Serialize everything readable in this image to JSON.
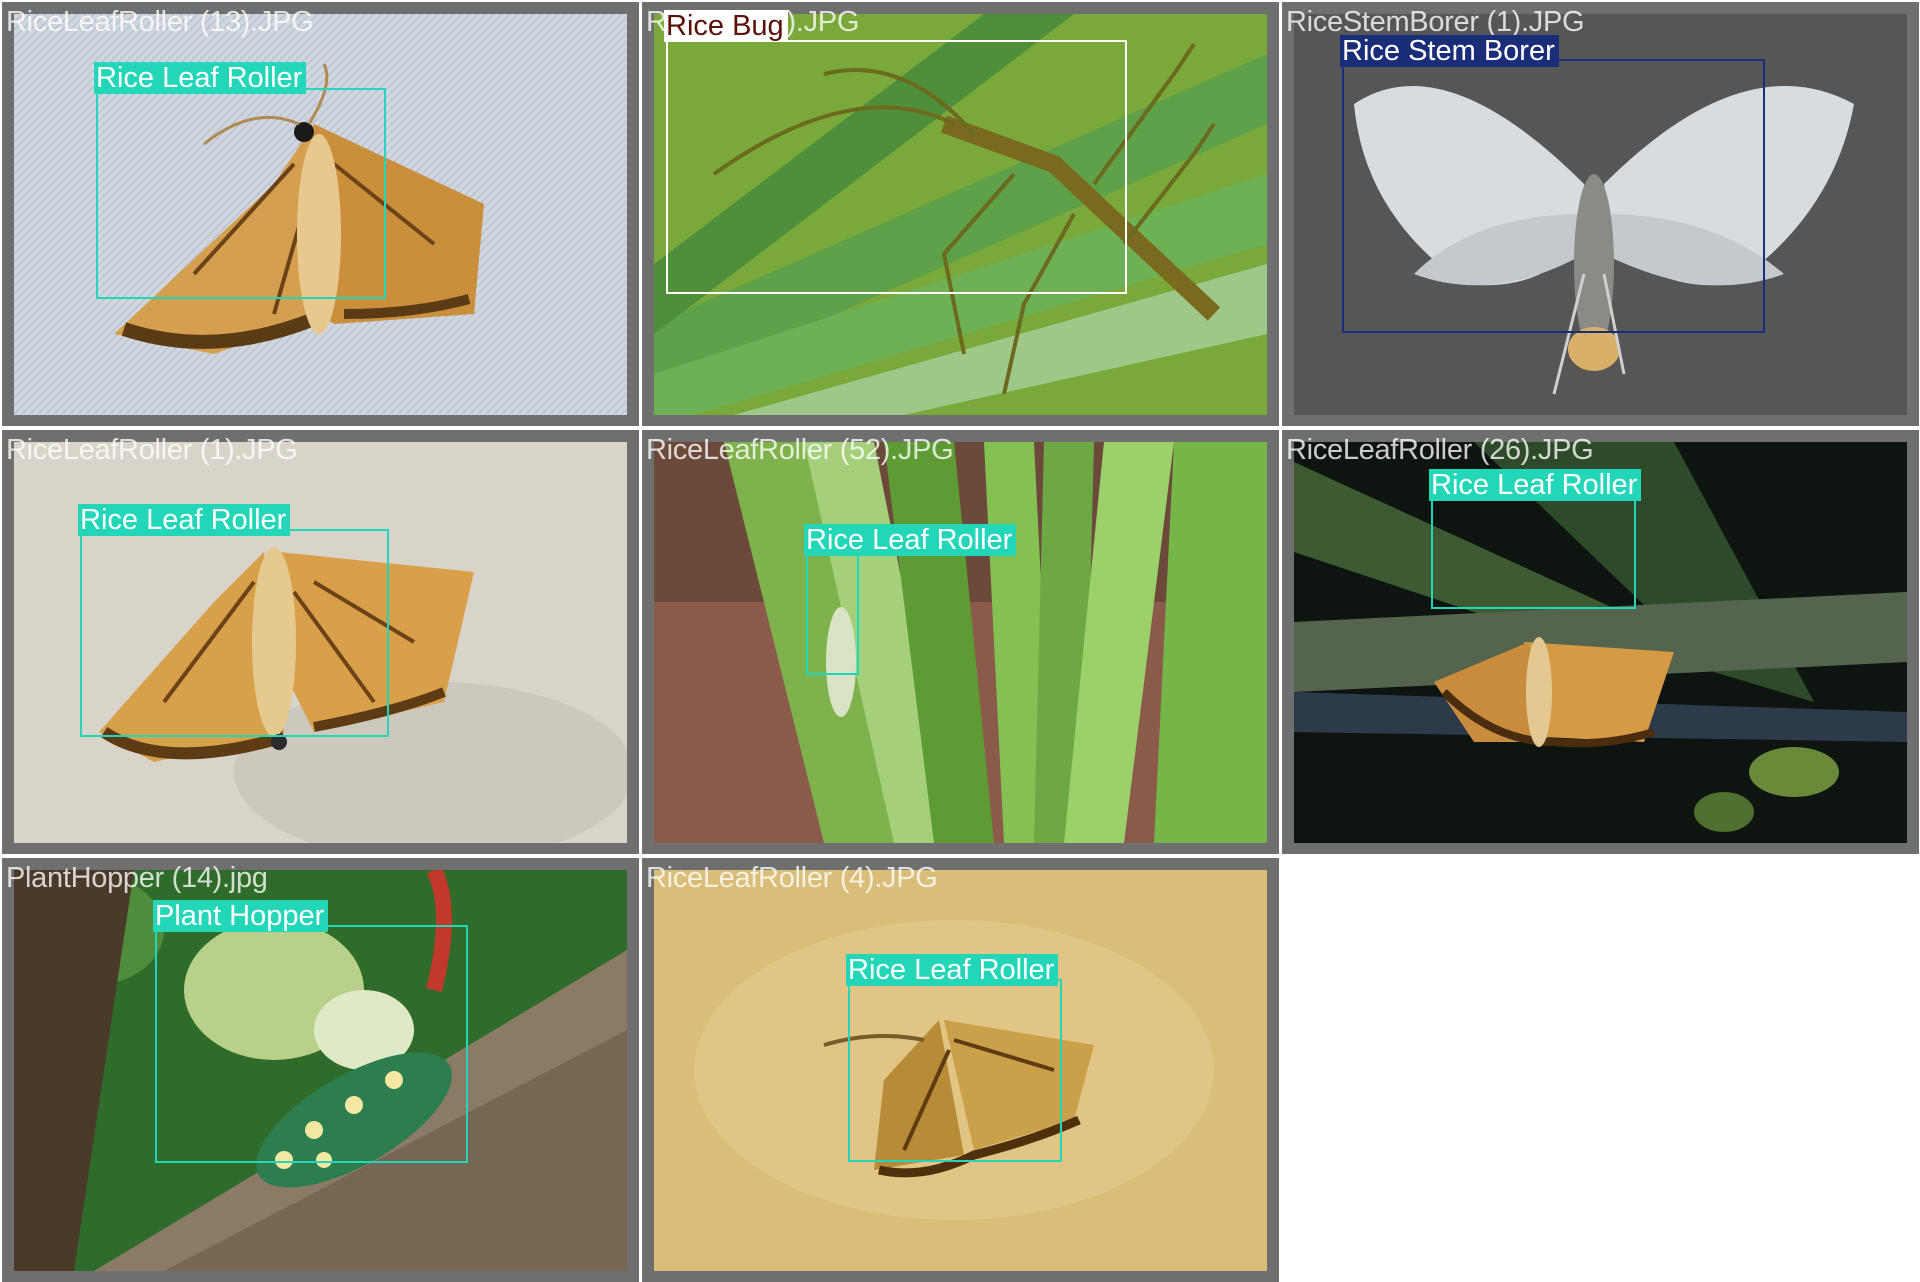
{
  "tiles": [
    {
      "filename": "RiceLeafRoller (13).JPG",
      "label": "Rice Leaf Roller",
      "color": "#23d6b8"
    },
    {
      "filename": "RiceBug (4).JPG",
      "label": "Rice Bug",
      "color": "#ffffff"
    },
    {
      "filename": "RiceStemBorer (1).JPG",
      "label": "Rice Stem Borer",
      "color": "#1a2d78"
    },
    {
      "filename": "RiceLeafRoller (1).JPG",
      "label": "Rice Leaf Roller",
      "color": "#23d6b8"
    },
    {
      "filename": "RiceLeafRoller (52).JPG",
      "label": "Rice Leaf Roller",
      "color": "#23d6b8"
    },
    {
      "filename": "RiceLeafRoller (26).JPG",
      "label": "Rice Leaf Roller",
      "color": "#23d6b8"
    },
    {
      "filename": "PlantHopper (14).jpg",
      "label": "Plant Hopper",
      "color": "#23d6b8"
    },
    {
      "filename": "RiceLeafRoller (4).JPG",
      "label": "Rice Leaf Roller",
      "color": "#23d6b8"
    }
  ]
}
